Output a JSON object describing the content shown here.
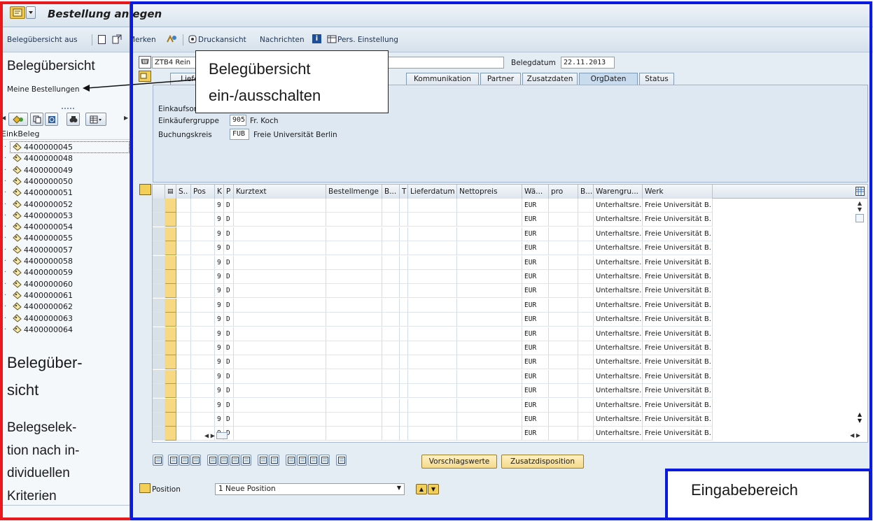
{
  "title": "Bestellung anlegen",
  "toolbar": {
    "overview_toggle": "Belegübersicht aus",
    "merken": "Merken",
    "druckansicht": "Druckansicht",
    "nachrichten": "Nachrichten",
    "pers_einstellung": "Pers. Einstellung"
  },
  "sidebar": {
    "title": "Belegübersicht",
    "subtitle": "Meine Bestellungen",
    "column_header": "EinkBeleg",
    "items": [
      "4400000045",
      "4400000048",
      "4400000049",
      "4400000050",
      "4400000051",
      "4400000052",
      "4400000053",
      "4400000054",
      "4400000055",
      "4400000057",
      "4400000058",
      "4400000059",
      "4400000060",
      "4400000061",
      "4400000062",
      "4400000063",
      "4400000064"
    ]
  },
  "header": {
    "doc_type": "ZTB4 Rein",
    "belegdatum_label": "Belegdatum",
    "belegdatum_value": "22.11.2013",
    "tabs": [
      {
        "label": "Liefer",
        "active": false
      },
      {
        "label": "Kommunikation",
        "active": false
      },
      {
        "label": "Partner",
        "active": false
      },
      {
        "label": "Zusatzdaten",
        "active": false
      },
      {
        "label": "OrgDaten",
        "active": true
      },
      {
        "label": "Status",
        "active": false
      }
    ],
    "org": {
      "einkaufsorg_label": "Einkaufsor",
      "einkaeufergruppe_label": "Einkäufergruppe",
      "einkaeufergruppe_value": "905",
      "einkaeufergruppe_text": "Fr. Koch",
      "buchungskreis_label": "Buchungskreis",
      "buchungskreis_value": "FUB",
      "buchungskreis_text": "Freie Universität Berlin"
    }
  },
  "callout": {
    "line1": "Belegübersicht",
    "line2": "ein-/ausschalten"
  },
  "items_table": {
    "columns": [
      "S..",
      "Pos",
      "K",
      "P",
      "Kurztext",
      "Bestellmenge",
      "B...",
      "T",
      "Lieferdatum",
      "Nettopreis",
      "Wä...",
      "pro",
      "B...",
      "Warengru...",
      "Werk"
    ],
    "row_template": {
      "k": "9",
      "p": "D",
      "waehrung": "EUR",
      "warengruppe": "Unterhaltsre...",
      "werk": "Freie Universität B..."
    },
    "row_count": 17
  },
  "bottom": {
    "vorschlagswerte": "Vorschlagswerte",
    "zusatzdisposition": "Zusatzdisposition",
    "position_label": "Position",
    "position_value": "1 Neue Position"
  },
  "annotations": {
    "left_title_line1": "Belegüber-",
    "left_title_line2": "sicht",
    "left_desc_lines": [
      "Belegselek-",
      "tion nach in-",
      "dividuellen",
      "Kriterien"
    ],
    "input_area": "Eingabebereich"
  },
  "colors": {
    "red_frame": "#e8191c",
    "blue_frame": "#0a1ae0",
    "sap_background": "#e4ecf4",
    "header_panel": "#dde8f3"
  }
}
